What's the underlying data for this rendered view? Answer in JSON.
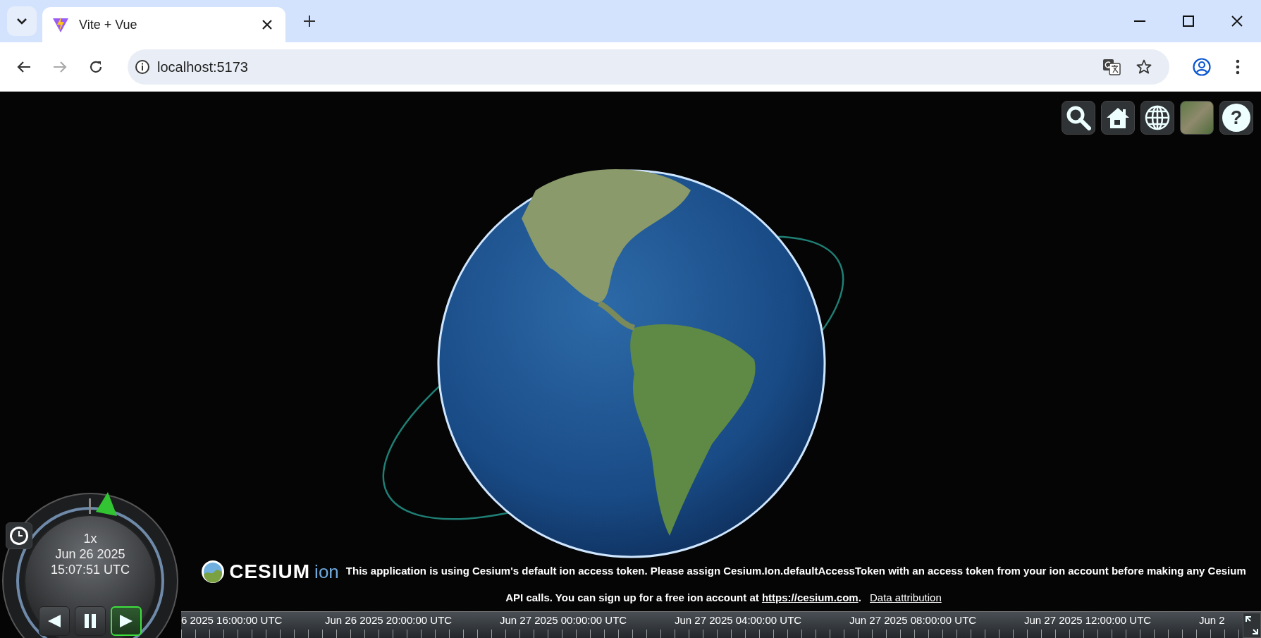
{
  "browser": {
    "tab": {
      "title": "Vite + Vue"
    },
    "address": "localhost:5173"
  },
  "toolbar": {
    "buttons": [
      {
        "kind": "search"
      },
      {
        "kind": "home"
      },
      {
        "kind": "globe"
      },
      {
        "kind": "imagery"
      },
      {
        "kind": "help",
        "label": "?"
      }
    ]
  },
  "animation": {
    "speed": "1x",
    "date": "Jun 26 2025",
    "time": "15:07:51 UTC",
    "buttons": [
      {
        "kind": "reverse",
        "selected": false
      },
      {
        "kind": "pause",
        "selected": false
      },
      {
        "kind": "play",
        "selected": true
      }
    ]
  },
  "logo": {
    "wordmark": "CESIUM",
    "suffix": "ion"
  },
  "credits": {
    "message": "This application is using Cesium's default ion access token. Please assign Cesium.Ion.defaultAccessToken with an access token from your ion account before making any Cesium API calls. You can sign up for a free ion account at",
    "link": "https://cesium.com",
    "link_suffix": ".",
    "attribution": "Data attribution"
  },
  "timeline": {
    "labels": [
      "6 2025 16:00:00 UTC",
      "Jun 26 2025 20:00:00 UTC",
      "Jun 27 2025 00:00:00 UTC",
      "Jun 27 2025 04:00:00 UTC",
      "Jun 27 2025 08:00:00 UTC",
      "Jun 27 2025 12:00:00 UTC",
      "Jun 2"
    ]
  }
}
